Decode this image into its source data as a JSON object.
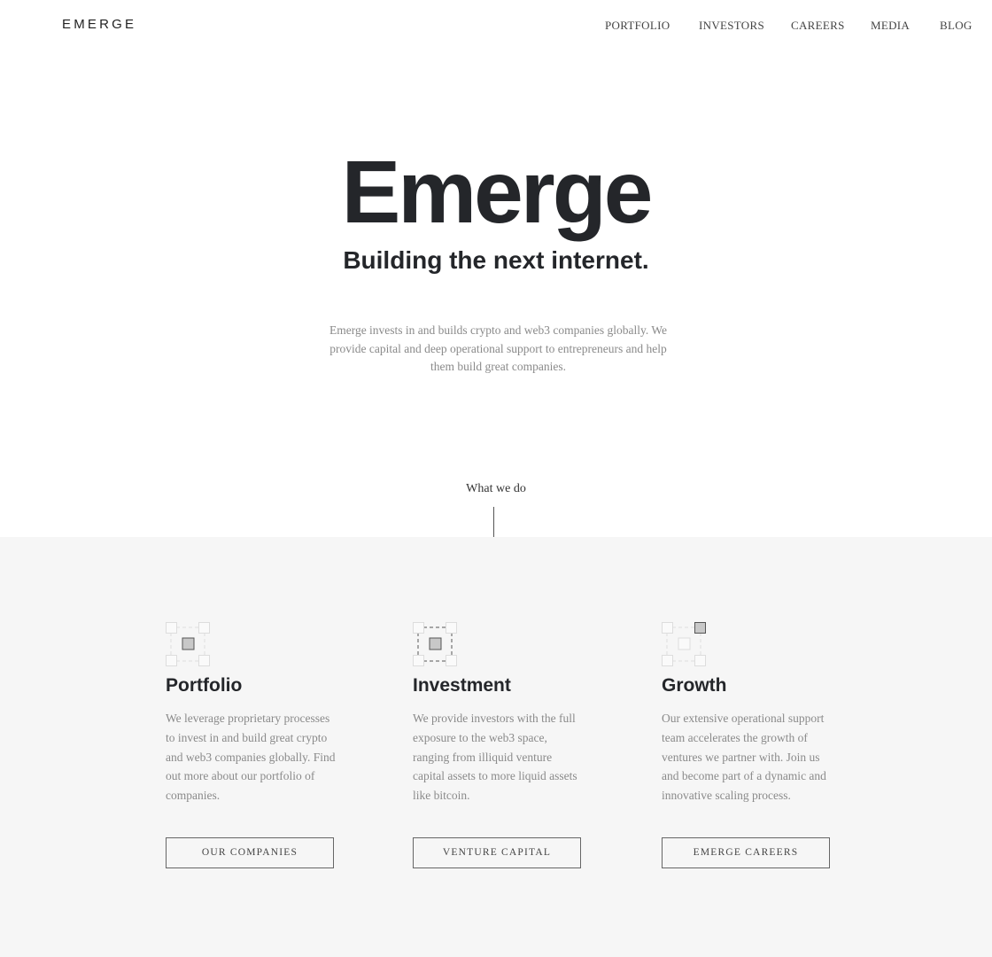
{
  "nav": {
    "logo": "EMERGE",
    "items": [
      "PORTFOLIO",
      "INVESTORS",
      "CAREERS",
      "MEDIA",
      "BLOG"
    ]
  },
  "hero": {
    "title": "Emerge",
    "subtitle": "Building the next internet.",
    "text": "Emerge invests in and builds crypto and web3 companies globally. We provide capital and deep operational support to entrepreneurs and help them build great companies."
  },
  "section": {
    "label": "What we do"
  },
  "columns": [
    {
      "icon": "network-center-icon",
      "title": "Portfolio",
      "text": "We leverage proprietary processes to invest in and build great crypto and web3 companies globally. Find out more about our portfolio of companies.",
      "button": "OUR COMPANIES"
    },
    {
      "icon": "network-dashed-icon",
      "title": "Investment",
      "text": "We provide investors with the full exposure to the web3 space, ranging from illiquid venture capital assets to more liquid assets like bitcoin.",
      "button": "VENTURE CAPITAL"
    },
    {
      "icon": "network-corner-icon",
      "title": "Growth",
      "text": "Our extensive operational support team accelerates the growth of ventures we partner with. Join us and become part of a dynamic and innovative scaling process.",
      "button": "EMERGE CAREERS"
    }
  ]
}
